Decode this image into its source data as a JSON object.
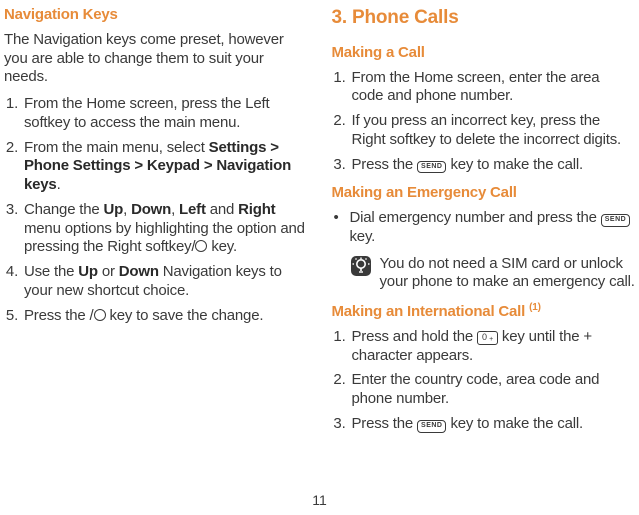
{
  "page_number": "11",
  "left": {
    "heading": "Navigation Keys",
    "intro": "The Navigation keys come preset, however you are able to change them to suit your needs.",
    "step1": "From the Home screen, press the Left softkey to access the main menu.",
    "step2_a": "From the main menu, select ",
    "step2_b": "Settings > Phone Settings > Keypad > Navigation keys",
    "step2_c": ".",
    "step3_a": "Change the ",
    "step3_up": "Up",
    "step3_s1": ", ",
    "step3_down": "Down",
    "step3_s2": ", ",
    "step3_left": "Left",
    "step3_s3": " and ",
    "step3_right": "Right",
    "step3_b": " menu options by highlighting the option and pressing the Right softkey/",
    "step3_c": " key.",
    "step4_a": "Use the ",
    "step4_up": "Up",
    "step4_s": " or ",
    "step4_down": "Down",
    "step4_b": " Navigation keys to your new shortcut choice.",
    "step5_a": "Press the /",
    "step5_b": " key to save the change."
  },
  "right": {
    "chapter": "3. Phone Calls",
    "making_a_call": "Making a Call",
    "c1_step1": "From the Home screen, enter the area code and phone number.",
    "c1_step2": "If you press an incorrect key, press the Right softkey to delete the incorrect digits.",
    "c1_step3_a": "Press the ",
    "c1_step3_b": " key to make the call.",
    "emergency": "Making an Emergency Call",
    "em_bullet_a": "Dial emergency number and press the ",
    "em_bullet_b": " key.",
    "note": "You do not need a SIM card or unlock your phone to make an emergency call.",
    "intl": "Making an International Call ",
    "intl_sup": "(1)",
    "i_step1_a": "Press and hold the ",
    "i_step1_b": " key until the + character appears.",
    "i_step2": "Enter the country code, area code and phone number.",
    "i_step3_a": "Press the ",
    "i_step3_b": " key to make the call.",
    "send_label": "SEND",
    "zero_label": "0",
    "zero_sub": "+"
  }
}
